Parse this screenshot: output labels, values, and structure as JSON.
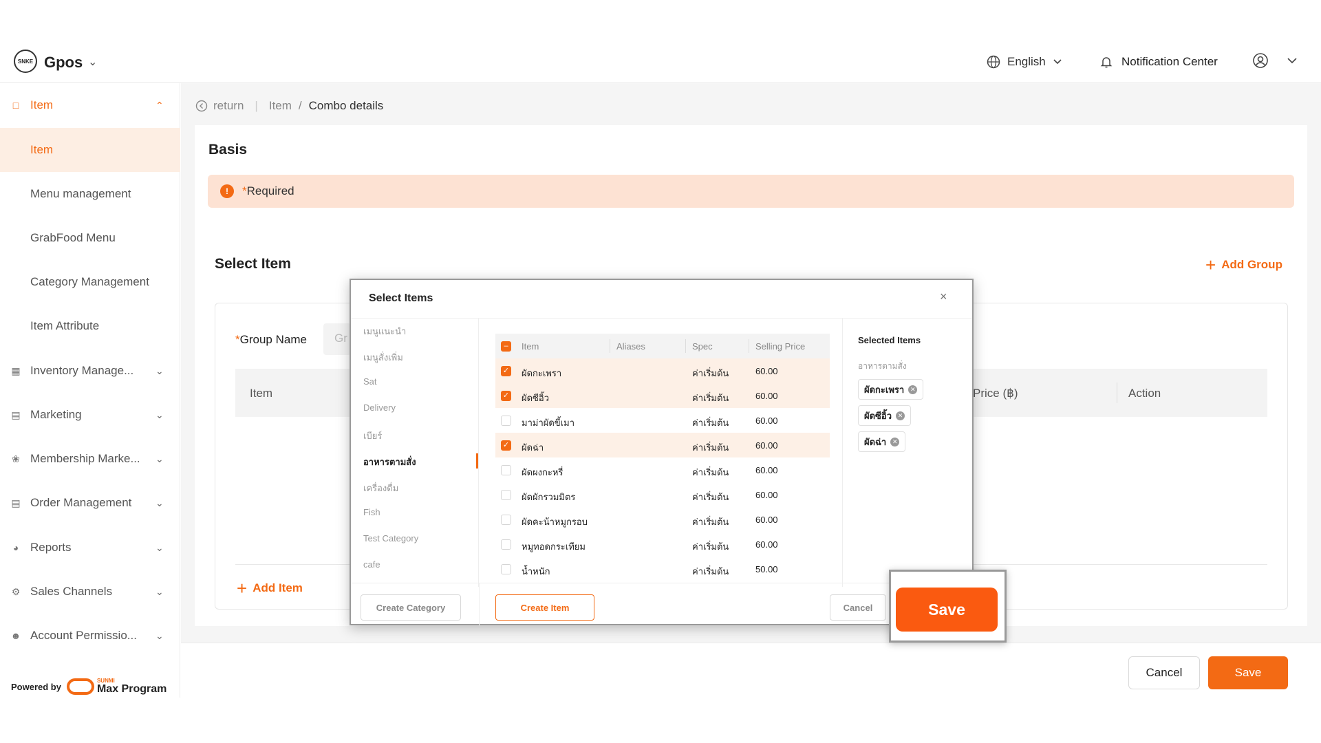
{
  "header": {
    "logo_text": "SNKE",
    "app_title": "Gpos",
    "language": "English",
    "notification": "Notification Center"
  },
  "sidebar": {
    "items": [
      {
        "label": "Item",
        "icon": "item-icon"
      },
      {
        "label": "Item"
      },
      {
        "label": "Menu management"
      },
      {
        "label": "GrabFood Menu"
      },
      {
        "label": "Category Management"
      },
      {
        "label": "Item Attribute"
      },
      {
        "label": "Inventory Manage...",
        "icon": "inventory-icon"
      },
      {
        "label": "Marketing",
        "icon": "marketing-icon"
      },
      {
        "label": "Membership Marke...",
        "icon": "membership-icon"
      },
      {
        "label": "Order Management",
        "icon": "order-icon"
      },
      {
        "label": "Reports",
        "icon": "reports-icon"
      },
      {
        "label": "Sales Channels",
        "icon": "channels-icon"
      },
      {
        "label": "Account Permissio...",
        "icon": "account-icon"
      }
    ],
    "powered_by": "Powered by",
    "brand_small": "SUNMI",
    "brand": "Max Program"
  },
  "breadcrumb": {
    "return": "return",
    "parent": "Item",
    "separator": "/",
    "current": "Combo details"
  },
  "basis": {
    "title": "Basis",
    "info_mark": "!",
    "required_star": "*",
    "required": "Required"
  },
  "select_item": {
    "title": "Select Item",
    "add_group": "Add Group",
    "group_name_label": "Group Name",
    "group_name_star": "*",
    "group_name_placeholder": "Gr",
    "col_item": "Item",
    "col_price": "Price (฿)",
    "col_action": "Action",
    "add_item": "Add Item"
  },
  "footer": {
    "cancel": "Cancel",
    "save": "Save"
  },
  "modal": {
    "title": "Select Items",
    "close": "×",
    "categories": [
      "เมนูแนะนำ",
      "เมนูสั่งเพิ่ม",
      "Sat",
      "Delivery",
      "เบียร์",
      "อาหารตามสั่ง",
      "เครื่องดื่ม",
      "Fish",
      "Test Category",
      "cafe"
    ],
    "active_category": "อาหารตามสั่ง",
    "table": {
      "headers": {
        "item": "Item",
        "aliases": "Aliases",
        "spec": "Spec",
        "price": "Selling Price"
      },
      "rows": [
        {
          "item": "ผัดกะเพรา",
          "aliases": "",
          "spec": "ค่าเริ่มต้น",
          "price": "60.00",
          "checked": true
        },
        {
          "item": "ผัดซีอิ้ว",
          "aliases": "",
          "spec": "ค่าเริ่มต้น",
          "price": "60.00",
          "checked": true
        },
        {
          "item": "มาม่าผัดขี้เมา",
          "aliases": "",
          "spec": "ค่าเริ่มต้น",
          "price": "60.00",
          "checked": false
        },
        {
          "item": "ผัดฉ่า",
          "aliases": "",
          "spec": "ค่าเริ่มต้น",
          "price": "60.00",
          "checked": true
        },
        {
          "item": "ผัดผงกะหรี่",
          "aliases": "",
          "spec": "ค่าเริ่มต้น",
          "price": "60.00",
          "checked": false
        },
        {
          "item": "ผัดผักรวมมิตร",
          "aliases": "",
          "spec": "ค่าเริ่มต้น",
          "price": "60.00",
          "checked": false
        },
        {
          "item": "ผัดคะน้าหมูกรอบ",
          "aliases": "",
          "spec": "ค่าเริ่มต้น",
          "price": "60.00",
          "checked": false
        },
        {
          "item": "หมูทอดกระเทียม",
          "aliases": "",
          "spec": "ค่าเริ่มต้น",
          "price": "60.00",
          "checked": false
        },
        {
          "item": "น้ำหนัก",
          "aliases": "",
          "spec": "ค่าเริ่มต้น",
          "price": "50.00",
          "checked": false
        }
      ]
    },
    "selected": {
      "title": "Selected Items",
      "category": "อาหารตามสั่ง",
      "items": [
        "ผัดกะเพรา",
        "ผัดซีอิ้ว",
        "ผัดฉ่า"
      ]
    },
    "buttons": {
      "create_category": "Create Category",
      "create_item": "Create Item",
      "cancel": "Cancel",
      "save": "Save"
    }
  },
  "colors": {
    "accent": "#f36a14",
    "accent_bright": "#fa5a10",
    "required_bg": "#fde2d3",
    "row_checked_bg": "#fdf0e6"
  }
}
